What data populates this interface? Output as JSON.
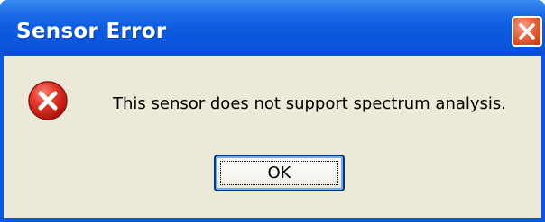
{
  "window": {
    "title": "Sensor Error"
  },
  "dialog": {
    "icon": "error-icon",
    "message": "This sensor does not support spectrum analysis.",
    "ok_label": "OK"
  },
  "colors": {
    "titlebar": "#0a55dc",
    "client": "#ece9d8",
    "close_button": "#d2441c",
    "error_icon": "#d11f1f"
  }
}
